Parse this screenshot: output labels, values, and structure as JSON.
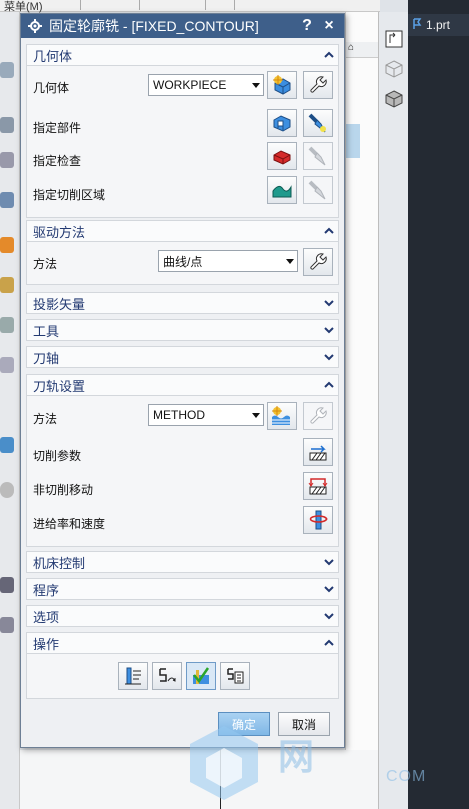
{
  "app": {
    "menu_fragment": "菜单(M)",
    "part_tab": "1.prt"
  },
  "watermark": {
    "text": "网",
    "sub": "COM"
  },
  "dialog": {
    "title": "固定轮廓铣 - [FIXED_CONTOUR]",
    "help_label": "?",
    "close_label": "×",
    "sections": {
      "geometry": {
        "label": "几何体",
        "geometry_label": "几何体",
        "geometry_value": "WORKPIECE",
        "specify_part": "指定部件",
        "specify_check": "指定检查",
        "specify_cut_area": "指定切削区域"
      },
      "drive_method": {
        "label": "驱动方法",
        "method_label": "方法",
        "method_value": "曲线/点"
      },
      "projection_vector": {
        "label": "投影矢量"
      },
      "tool": {
        "label": "工具"
      },
      "tool_axis": {
        "label": "刀轴"
      },
      "path_settings": {
        "label": "刀轨设置",
        "method_label": "方法",
        "method_value": "METHOD",
        "cut_params": "切削参数",
        "non_cut_moves": "非切削移动",
        "feeds_speeds": "进给率和速度"
      },
      "machine_control": {
        "label": "机床控制"
      },
      "program": {
        "label": "程序"
      },
      "options": {
        "label": "选项"
      },
      "actions": {
        "label": "操作"
      }
    },
    "ok_label": "确定",
    "cancel_label": "取消"
  }
}
